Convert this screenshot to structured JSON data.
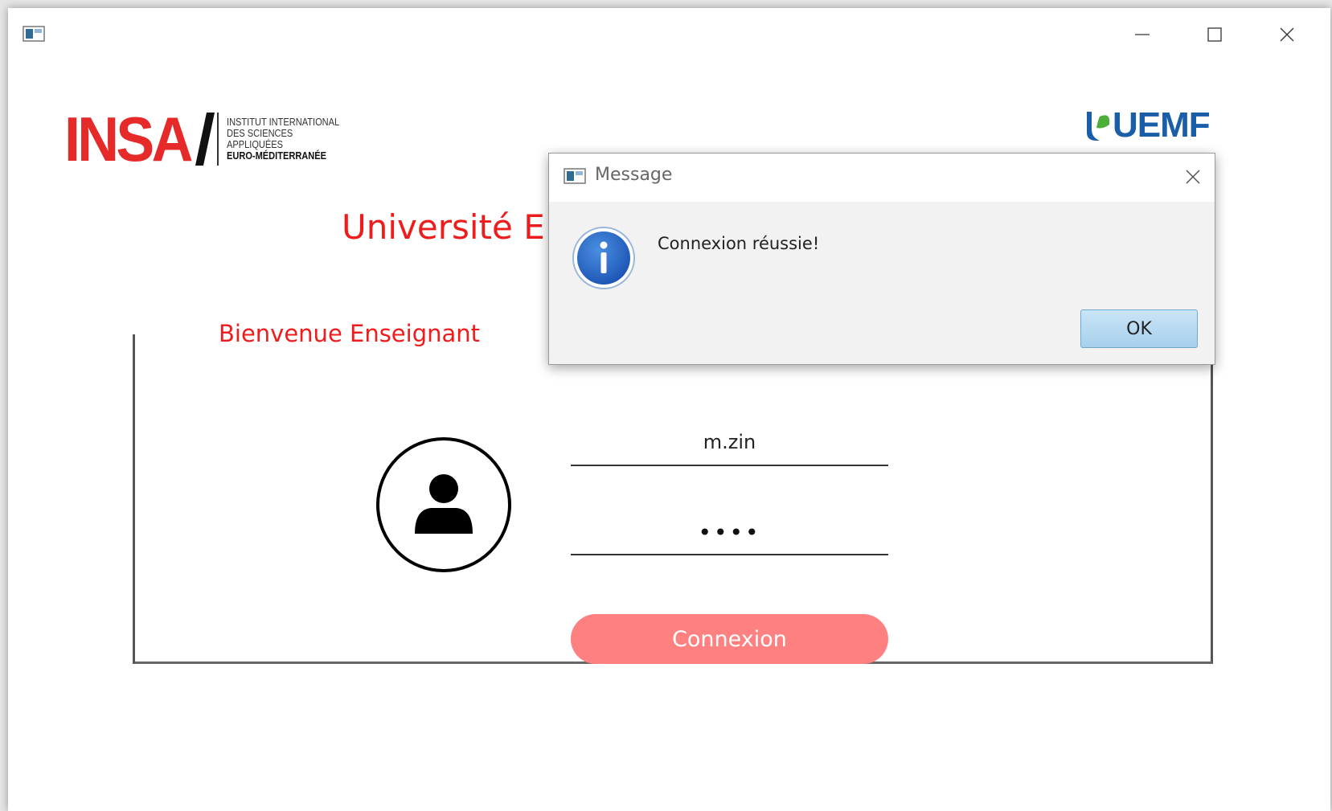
{
  "window": {
    "app_icon": "java-app-icon",
    "controls": {
      "minimize": "minimize-icon",
      "maximize": "maximize-icon",
      "close": "close-icon"
    }
  },
  "logos": {
    "insa": {
      "word": "INSA",
      "lines": [
        "INSTITUT INTERNATIONAL",
        "DES SCIENCES",
        "APPLIQUÉES",
        "EURO-MÉDITERRANÉE"
      ],
      "color": "#e62a2a"
    },
    "uemf": {
      "word": "UEMF",
      "color": "#1a5ea8"
    }
  },
  "main": {
    "title_visible": "Université E",
    "welcome": "Bienvenue Enseignant",
    "accent_color": "#ee1c1c"
  },
  "form": {
    "username_value": "m.zin",
    "password_value": "••••",
    "submit_label": "Connexion",
    "submit_color": "#ff8080",
    "avatar_icon": "user-avatar-icon"
  },
  "dialog": {
    "title": "Message",
    "message": "Connexion réussie!",
    "icon": "info-icon",
    "ok_label": "OK"
  }
}
